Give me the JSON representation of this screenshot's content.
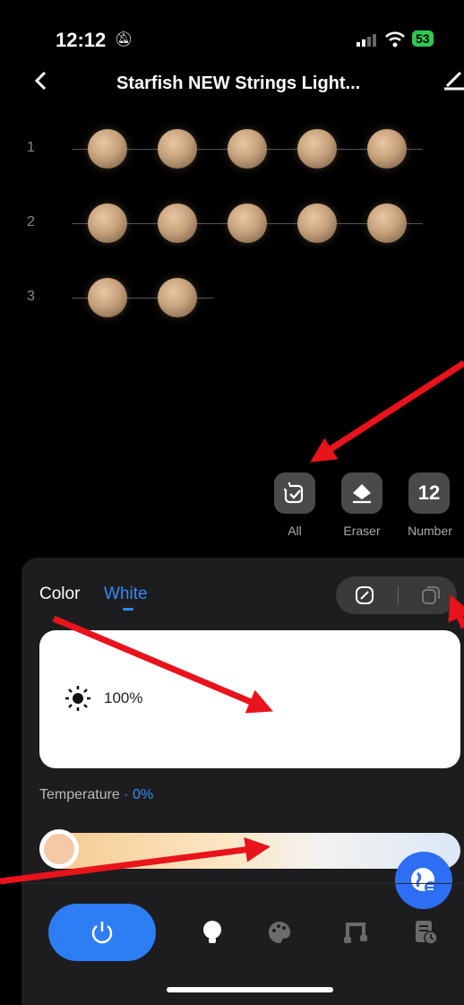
{
  "status_bar": {
    "time": "12:12",
    "battery": "53"
  },
  "header": {
    "title": "Starfish NEW Strings Light..."
  },
  "strings": [
    {
      "number": "1",
      "bulb_count": 5
    },
    {
      "number": "2",
      "bulb_count": 5
    },
    {
      "number": "3",
      "bulb_count": 2
    }
  ],
  "tools": [
    {
      "label": "All",
      "icon": "select-all-icon"
    },
    {
      "label": "Eraser",
      "icon": "eraser-icon"
    },
    {
      "label": "Number",
      "value": "12"
    }
  ],
  "tabs": {
    "color": "Color",
    "white": "White",
    "active": "White"
  },
  "brightness": {
    "value": "100%"
  },
  "temperature": {
    "label": "Temperature",
    "value": "0%",
    "level": 0
  },
  "nav": {
    "items": [
      "power",
      "bulb",
      "palette",
      "music",
      "schedule"
    ],
    "active": "power"
  },
  "colors": {
    "accent": "#2d8cff",
    "annotation": "#e8131b"
  }
}
